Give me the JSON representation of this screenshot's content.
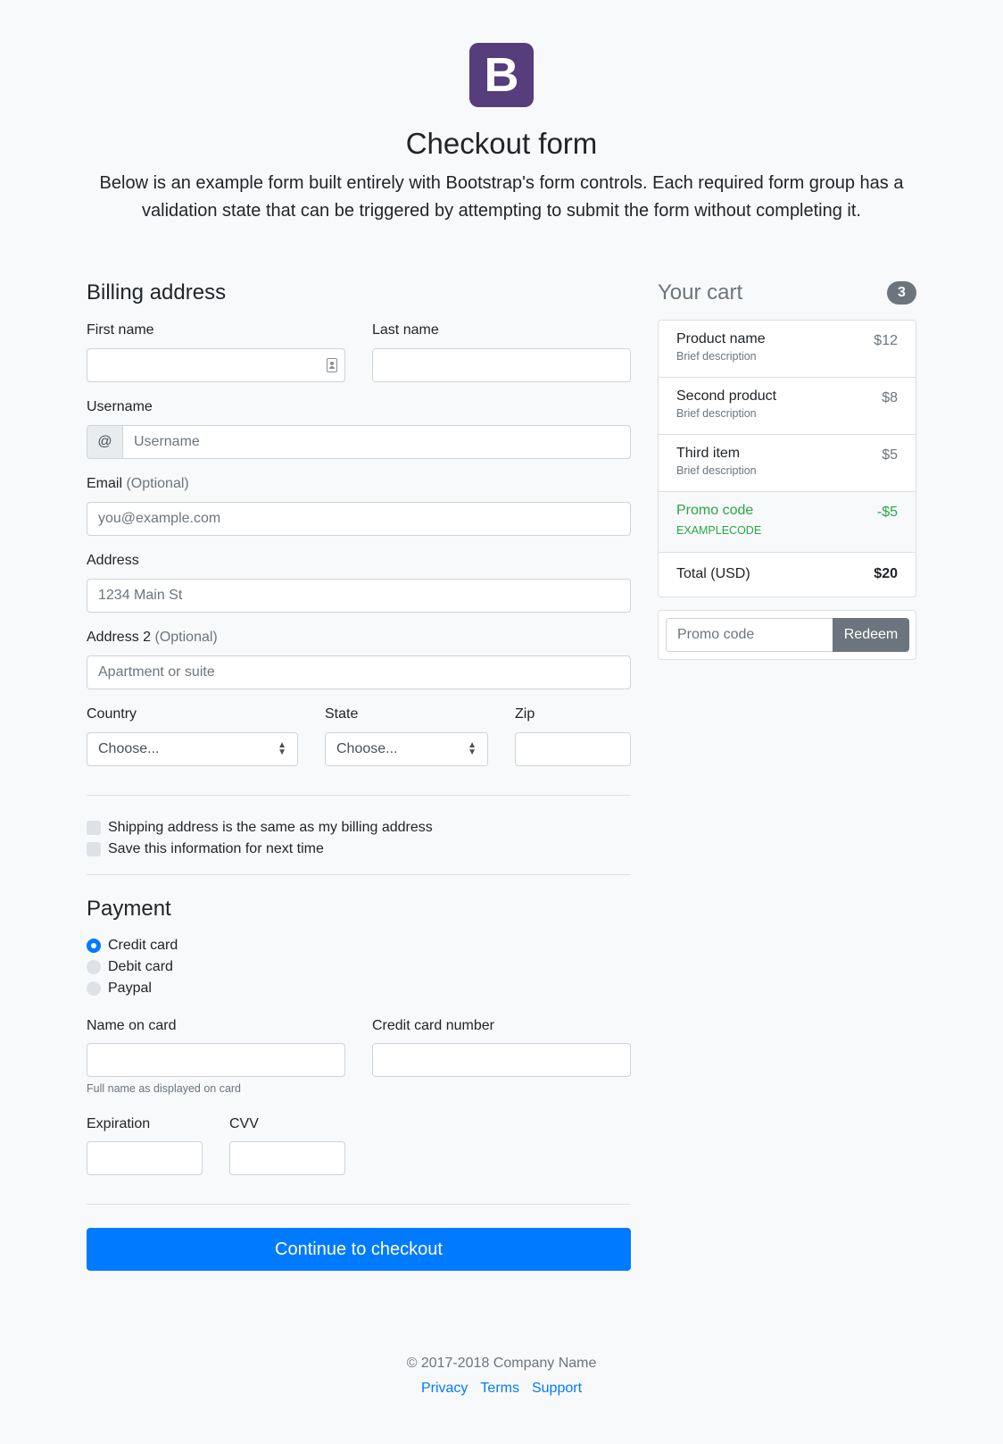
{
  "header": {
    "logo_letter": "B",
    "title": "Checkout form",
    "lead": "Below is an example form built entirely with Bootstrap's form controls. Each required form group has a validation state that can be triggered by attempting to submit the form without completing it."
  },
  "billing": {
    "heading": "Billing address",
    "first_name_label": "First name",
    "last_name_label": "Last name",
    "username_label": "Username",
    "username_prefix": "@",
    "username_placeholder": "Username",
    "email_label": "Email",
    "email_optional": "(Optional)",
    "email_placeholder": "you@example.com",
    "address_label": "Address",
    "address_placeholder": "1234 Main St",
    "address2_label": "Address 2",
    "address2_optional": "(Optional)",
    "address2_placeholder": "Apartment or suite",
    "country_label": "Country",
    "country_value": "Choose...",
    "state_label": "State",
    "state_value": "Choose...",
    "zip_label": "Zip",
    "same_address_label": "Shipping address is the same as my billing address",
    "save_info_label": "Save this information for next time"
  },
  "payment": {
    "heading": "Payment",
    "methods": [
      "Credit card",
      "Debit card",
      "Paypal"
    ],
    "selected_method": "Credit card",
    "name_on_card_label": "Name on card",
    "name_on_card_help": "Full name as displayed on card",
    "card_number_label": "Credit card number",
    "expiration_label": "Expiration",
    "cvv_label": "CVV",
    "submit_label": "Continue to checkout"
  },
  "cart": {
    "title": "Your cart",
    "count": "3",
    "items": [
      {
        "name": "Product name",
        "desc": "Brief description",
        "price": "$12"
      },
      {
        "name": "Second product",
        "desc": "Brief description",
        "price": "$8"
      },
      {
        "name": "Third item",
        "desc": "Brief description",
        "price": "$5"
      }
    ],
    "promo": {
      "name": "Promo code",
      "code": "EXAMPLECODE",
      "amount": "-$5"
    },
    "total_label": "Total (USD)",
    "total_value": "$20",
    "promo_placeholder": "Promo code",
    "redeem_label": "Redeem"
  },
  "footer": {
    "copyright": "© 2017-2018 Company Name",
    "links": [
      "Privacy",
      "Terms",
      "Support"
    ]
  },
  "colors": {
    "primary": "#007bff",
    "brand": "#563d7c",
    "success": "#28a745",
    "secondary": "#6c757d"
  }
}
